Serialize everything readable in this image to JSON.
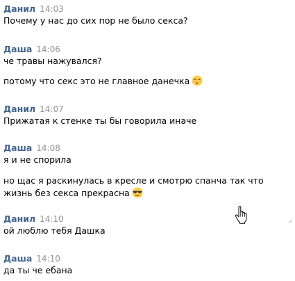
{
  "messages": [
    {
      "author": "Данил",
      "time": "14:03",
      "lines": [
        "Почему у нас до сих пор не было секса?"
      ]
    },
    {
      "author": "Даша",
      "time": "14:06",
      "lines": [
        "че травы нажувался?",
        "потому что секс это не главное данечка"
      ]
    },
    {
      "author": "Данил",
      "time": "14:07",
      "lines": [
        "Прижатая к стенке ты бы говорила иначе"
      ]
    },
    {
      "author": "Даша",
      "time": "14:08",
      "lines": [
        "я и не спорила",
        "но щас я раскинулась в кресле и смотрю спанча так что жизнь без секса прекрасна"
      ]
    },
    {
      "author": "Данил",
      "time": "14:10",
      "lines": [
        "ой люблю тебя Дашка"
      ]
    },
    {
      "author": "Даша",
      "time": "14:10",
      "lines": [
        "да ты че ебана"
      ]
    }
  ],
  "emojis": {
    "kiss": "kissing-closed-eyes-emoji",
    "cool": "sunglasses-emoji"
  },
  "colors": {
    "author": "#42648b",
    "time": "#939393",
    "text": "#000000",
    "background": "#ffffff",
    "emoji_face": "#ffcc4d"
  },
  "icons": {
    "cursor": "hand-pointer-cursor-icon"
  }
}
